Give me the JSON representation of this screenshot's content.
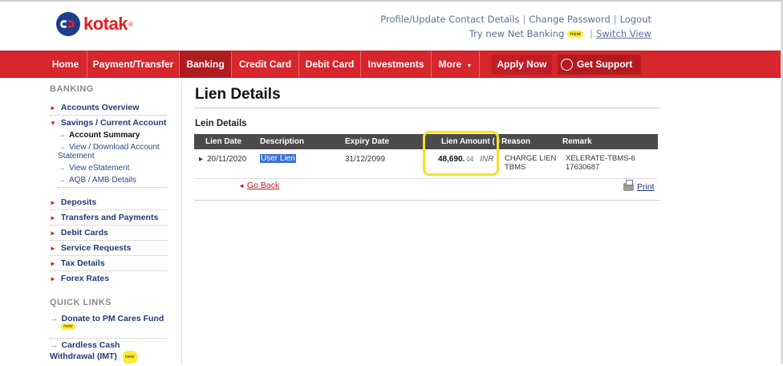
{
  "header": {
    "logo_text": "kotak",
    "logo_reg": "®",
    "links_row1": [
      "Profile/Update Contact Details",
      "Change Password",
      "Logout"
    ],
    "try_new": "Try new Net Banking",
    "new_badge": "new",
    "switch_view": "Switch View"
  },
  "nav": {
    "items": [
      "Home",
      "Payment/Transfer",
      "Banking",
      "Credit Card",
      "Debit Card",
      "Investments",
      "More"
    ],
    "active": "Banking",
    "apply_now": "Apply Now",
    "get_support": "Get Support"
  },
  "sidebar": {
    "heading": "BANKING",
    "items": [
      "Accounts Overview",
      "Savings / Current Account",
      "Deposits",
      "Transfers and Payments",
      "Debit Cards",
      "Service Requests",
      "Tax Details",
      "Forex Rates"
    ],
    "sub_items": [
      "Account Summary",
      "View / Download Account Statement",
      "View eStatement",
      "AQB / AMB Details"
    ],
    "quick_links_heading": "QUICK LINKS",
    "quick_links": [
      "Donate to PM Cares Fund",
      "Cardless Cash Withdrawal (IMT)"
    ]
  },
  "main": {
    "title": "Lien Details",
    "section_label": "Lein Details",
    "columns": [
      "Lien Date",
      "Description",
      "Expiry Date",
      "Lien Amount ( )",
      "Reason",
      "Remark"
    ],
    "row": {
      "lien_date": "20/11/2020",
      "description": "User Lien",
      "expiry_date": "31/12/2099",
      "amount": "48,690.",
      "amount_dec": "04",
      "currency": "INR",
      "reason": "CHARGE LIEN TBMS",
      "remark": "XELERATE-TBMS-617630687"
    },
    "back_label": "Go Back",
    "print_label": "Print"
  }
}
